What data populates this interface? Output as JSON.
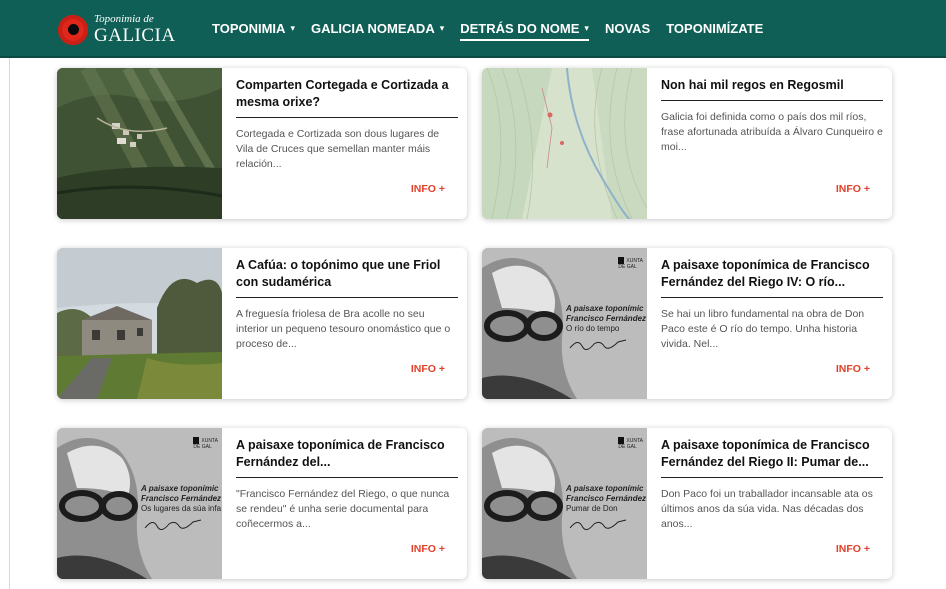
{
  "header": {
    "logo_small": "Toponimia de",
    "logo_big": "GALICIA",
    "nav": [
      {
        "label": "TOPONIMIA",
        "caret": "▾"
      },
      {
        "label": "GALICIA NOMEADA",
        "caret": "▾"
      },
      {
        "label": "DETRÁS DO NOME",
        "caret": "▾",
        "active": true
      },
      {
        "label": "NOVAS"
      },
      {
        "label": "TOPONIMÍZATE"
      }
    ]
  },
  "cards": [
    {
      "title": "Comparten Cortegada e Cortizada a mesma orixe?",
      "text": "Cortegada e Cortizada son dous lugares de Vila de Cruces que semellan manter máis relación...",
      "info": "INFO +"
    },
    {
      "title": "Non hai mil regos en Regosmil",
      "text": "Galicia foi definida como o país dos mil ríos, frase afortunada atribuída a Álvaro Cunqueiro e moi...",
      "info": "INFO +"
    },
    {
      "title": "A Cafúa: o topónimo que une Friol con sudamérica",
      "text": "A freguesía friolesa de Bra acolle no seu interior un pequeno tesouro onomástico que o proceso de...",
      "info": "INFO +"
    },
    {
      "title": "A paisaxe toponímica de Francisco Fernández del Riego IV: O río...",
      "text": "Se hai un libro fundamental na obra de Don Paco este é O río do tempo. Unha historia vivida. Nel...",
      "info": "INFO +",
      "img_line1": "A paisaxe toponímic",
      "img_line2": "Francisco Fernández",
      "img_line3": "O río do tempo"
    },
    {
      "title": "A paisaxe toponímica de Francisco Fernández del...",
      "text": "\"Francisco Fernández del Riego, o que nunca se rendeu\" é unha serie documental para coñecermos a...",
      "info": "INFO +",
      "img_line1": "A paisaxe toponímic",
      "img_line2": "Francisco Fernández",
      "img_line3": "Os lugares da súa infa"
    },
    {
      "title": "A paisaxe toponímica de Francisco Fernández del Riego II: Pumar de...",
      "text": "Don Paco foi un traballador incansable ata os últimos anos da súa vida. Nas décadas dos anos...",
      "info": "INFO +",
      "img_line1": "A paisaxe toponímic",
      "img_line2": "Francisco Fernández",
      "img_line3": "Pumar de Don"
    }
  ],
  "colors": {
    "header_bg": "#0f5f56",
    "accent": "#e0412a",
    "logo_red": "#e0271c"
  }
}
